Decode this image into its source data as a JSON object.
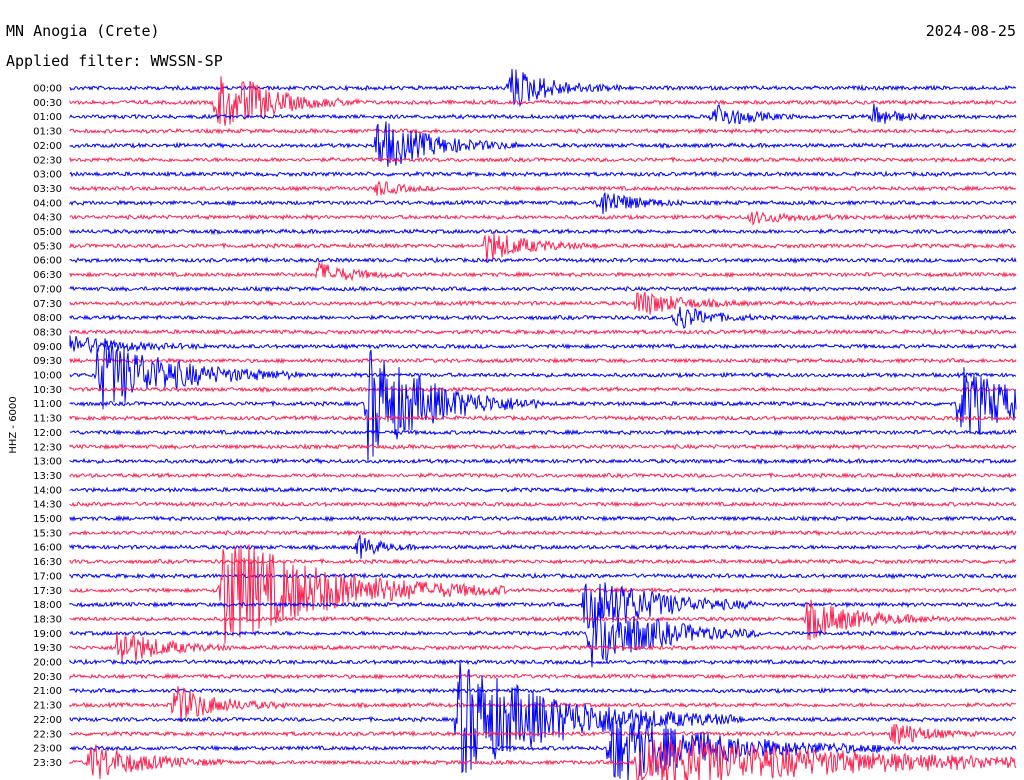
{
  "header": {
    "station": "MN Anogia (Crete)",
    "filter": "Applied filter: WWSSN-SP",
    "date": "2024-08-25"
  },
  "chart_data": {
    "type": "line",
    "title": "MN Anogia (Crete)",
    "ylabel": "HHZ - 6000",
    "trace_colors": [
      "#0000ff",
      "#ff2050"
    ],
    "row_labels": [
      "00:00",
      "00:30",
      "01:00",
      "01:30",
      "02:00",
      "02:30",
      "03:00",
      "03:30",
      "04:00",
      "04:30",
      "05:00",
      "05:30",
      "06:00",
      "06:30",
      "07:00",
      "07:30",
      "08:00",
      "08:30",
      "09:00",
      "09:30",
      "10:00",
      "10:30",
      "11:00",
      "11:30",
      "12:00",
      "12:30",
      "13:00",
      "13:30",
      "14:00",
      "14:30",
      "15:00",
      "15:30",
      "16:00",
      "16:30",
      "17:00",
      "17:30",
      "18:00",
      "18:30",
      "19:00",
      "19:30",
      "20:00",
      "20:30",
      "21:00",
      "21:30",
      "22:00",
      "22:30",
      "23:00",
      "23:30"
    ],
    "events": [
      {
        "row": 0,
        "x": 0.465,
        "amp": 22,
        "dur": 0.04
      },
      {
        "row": 1,
        "x": 0.155,
        "amp": 30,
        "dur": 0.05
      },
      {
        "row": 1,
        "x": 0.185,
        "amp": 8,
        "dur": 0.02
      },
      {
        "row": 2,
        "x": 0.68,
        "amp": 14,
        "dur": 0.03
      },
      {
        "row": 2,
        "x": 0.85,
        "amp": 12,
        "dur": 0.02
      },
      {
        "row": 4,
        "x": 0.325,
        "amp": 28,
        "dur": 0.05
      },
      {
        "row": 7,
        "x": 0.325,
        "amp": 8,
        "dur": 0.02
      },
      {
        "row": 8,
        "x": 0.56,
        "amp": 15,
        "dur": 0.03
      },
      {
        "row": 9,
        "x": 0.72,
        "amp": 6,
        "dur": 0.04
      },
      {
        "row": 11,
        "x": 0.44,
        "amp": 16,
        "dur": 0.04
      },
      {
        "row": 13,
        "x": 0.262,
        "amp": 12,
        "dur": 0.03
      },
      {
        "row": 15,
        "x": 0.6,
        "amp": 14,
        "dur": 0.04
      },
      {
        "row": 16,
        "x": 0.64,
        "amp": 14,
        "dur": 0.03
      },
      {
        "row": 18,
        "x": 0.0,
        "amp": 10,
        "dur": 0.05
      },
      {
        "row": 20,
        "x": 0.03,
        "amp": 40,
        "dur": 0.07
      },
      {
        "row": 22,
        "x": 0.315,
        "amp": 60,
        "dur": 0.06
      },
      {
        "row": 22,
        "x": 0.94,
        "amp": 40,
        "dur": 0.06
      },
      {
        "row": 32,
        "x": 0.305,
        "amp": 12,
        "dur": 0.02
      },
      {
        "row": 35,
        "x": 0.16,
        "amp": 60,
        "dur": 0.1
      },
      {
        "row": 36,
        "x": 0.545,
        "amp": 38,
        "dur": 0.06
      },
      {
        "row": 37,
        "x": 0.78,
        "amp": 20,
        "dur": 0.05
      },
      {
        "row": 38,
        "x": 0.55,
        "amp": 40,
        "dur": 0.06
      },
      {
        "row": 39,
        "x": 0.05,
        "amp": 20,
        "dur": 0.04
      },
      {
        "row": 43,
        "x": 0.11,
        "amp": 20,
        "dur": 0.04
      },
      {
        "row": 44,
        "x": 0.41,
        "amp": 60,
        "dur": 0.1
      },
      {
        "row": 45,
        "x": 0.87,
        "amp": 14,
        "dur": 0.03
      },
      {
        "row": 46,
        "x": 0.57,
        "amp": 38,
        "dur": 0.1
      },
      {
        "row": 47,
        "x": 0.02,
        "amp": 20,
        "dur": 0.05
      },
      {
        "row": 47,
        "x": 0.6,
        "amp": 30,
        "dur": 0.2
      }
    ]
  }
}
